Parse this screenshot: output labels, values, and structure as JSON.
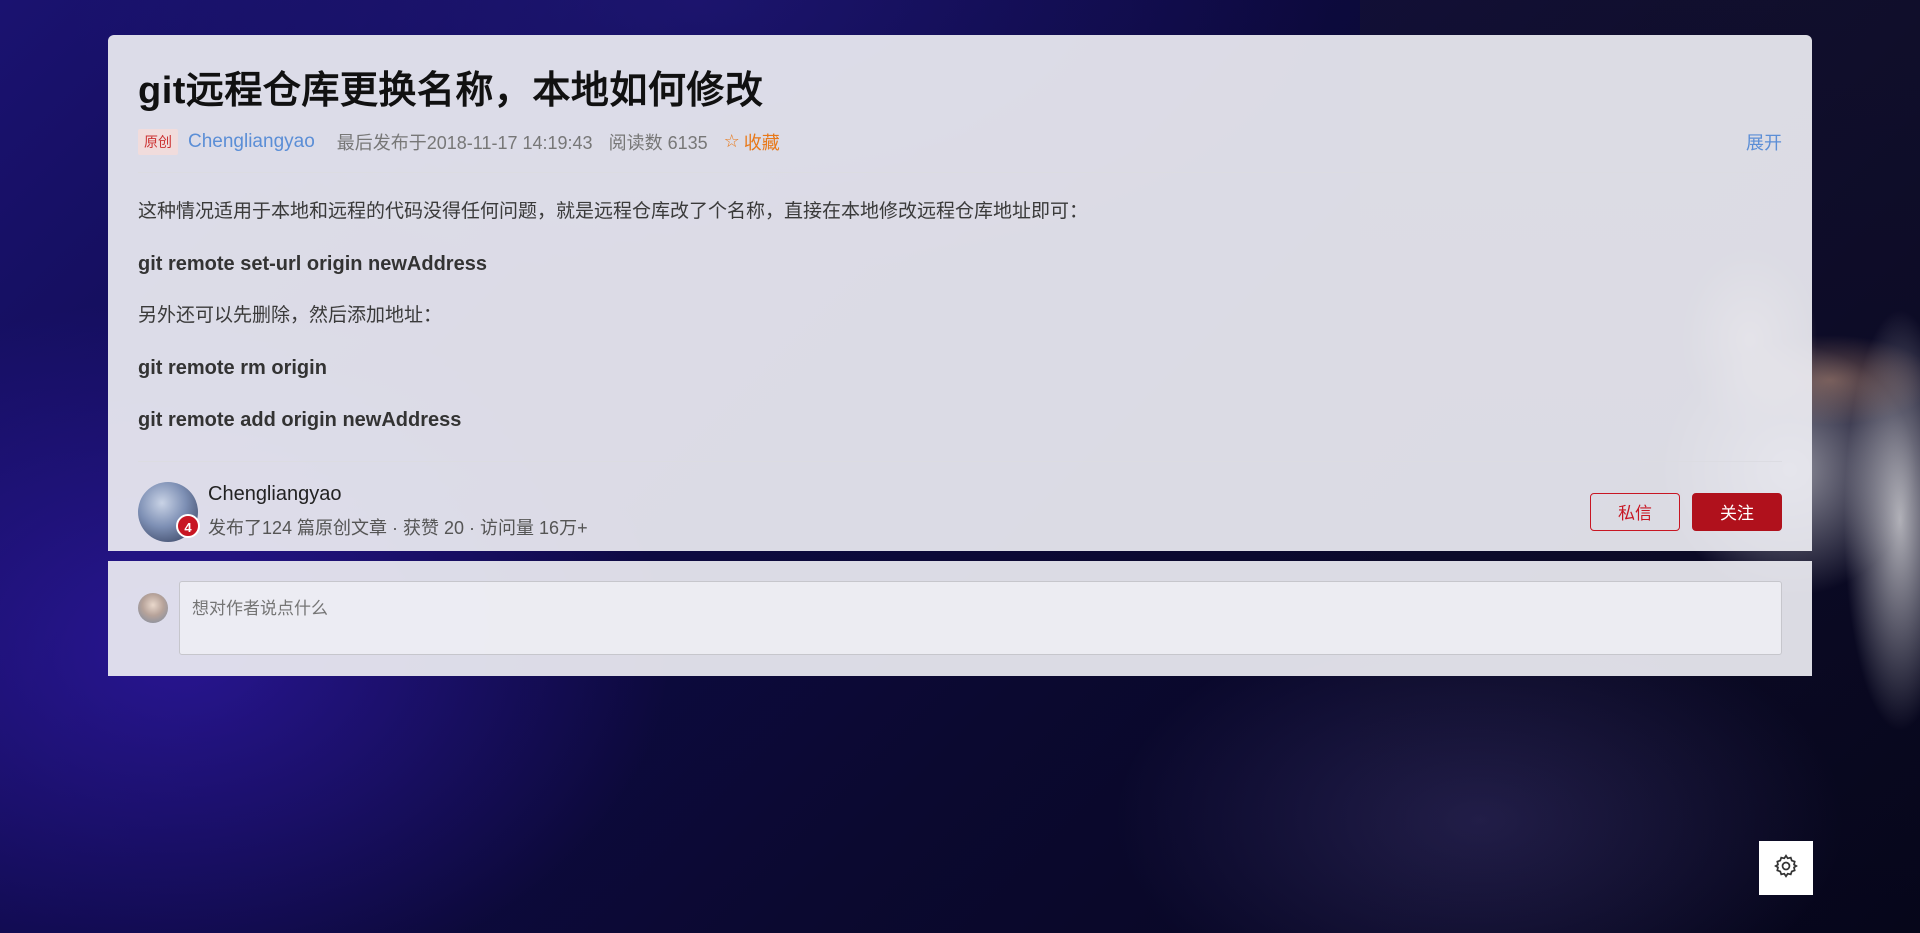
{
  "article": {
    "title": "git远程仓库更换名称，本地如何修改",
    "badge": "原创",
    "author": "Chengliangyao",
    "publish_time": "最后发布于2018-11-17 14:19:43",
    "reads": "阅读数 6135",
    "favorite_label": "收藏",
    "expand_label": "展开",
    "paragraphs": [
      "这种情况适用于本地和远程的代码没得任何问题，就是远程仓库改了个名称，直接在本地修改远程仓库地址即可：",
      "git remote set-url origin newAddress",
      "另外还可以先删除，然后添加地址：",
      "git remote rm origin",
      "git remote add origin newAddress"
    ]
  },
  "author_bar": {
    "name": "Chengliangyao",
    "stats": "发布了124 篇原创文章 · 获赞 20 · 访问量 16万+",
    "years_badge": "4",
    "message_label": "私信",
    "follow_label": "关注"
  },
  "comment": {
    "placeholder": "想对作者说点什么"
  },
  "colors": {
    "accent_red": "#b0111c",
    "link_blue": "#5b8ed6",
    "favorite_orange": "#e8791a"
  }
}
